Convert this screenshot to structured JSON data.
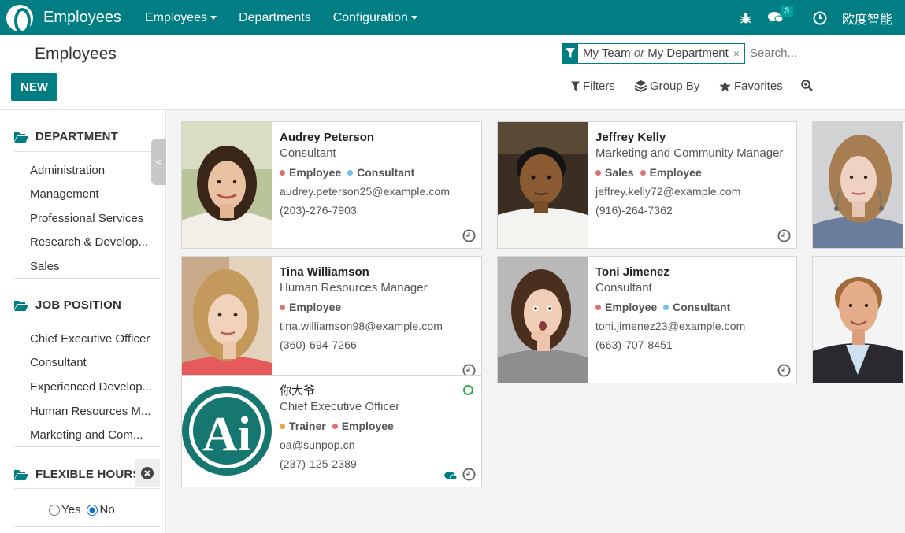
{
  "navbar": {
    "app_name": "Employees",
    "menus": [
      "Employees",
      "Departments",
      "Configuration"
    ],
    "messages_count": "3",
    "company": "欧度智能",
    "icons": [
      "bug-icon",
      "chat-icon",
      "clock-icon"
    ]
  },
  "control_panel": {
    "title": "Employees",
    "new_label": "NEW",
    "facet": {
      "part1": "My Team",
      "connector": "or",
      "part2": "My Department"
    },
    "search_placeholder": "Search...",
    "filters_label": "Filters",
    "groupby_label": "Group By",
    "favorites_label": "Favorites"
  },
  "sidebar": {
    "department": {
      "title": "DEPARTMENT",
      "items": [
        "Administration",
        "Management",
        "Professional Services",
        "Research & Develop...",
        "Sales"
      ]
    },
    "job_position": {
      "title": "JOB POSITION",
      "items": [
        "Chief Executive Officer",
        "Consultant",
        "Experienced Develop...",
        "Human Resources M...",
        "Marketing and Com..."
      ]
    },
    "flexible_hours": {
      "title": "FLEXIBLE HOURS",
      "yes": "Yes",
      "no": "No",
      "selected": "No"
    }
  },
  "colors": {
    "brand": "#017e84",
    "tag_employee": "#e07070",
    "tag_consultant": "#6cc1ed",
    "tag_sales": "#e07070",
    "tag_trainer": "#f0a050"
  },
  "cards": [
    {
      "name": "Audrey Peterson",
      "job": "Consultant",
      "tags": [
        "Employee",
        "Consultant"
      ],
      "email": "audrey.peterson25@example.com",
      "phone": "(203)-276-7903"
    },
    {
      "name": "Jeffrey Kelly",
      "job": "Marketing and Community Manager",
      "tags": [
        "Sales",
        "Employee"
      ],
      "email": "jeffrey.kelly72@example.com",
      "phone": "(916)-264-7362"
    },
    {
      "name": "Tina Williamson",
      "job": "Human Resources Manager",
      "tags": [
        "Employee"
      ],
      "email": "tina.williamson98@example.com",
      "phone": "(360)-694-7266"
    },
    {
      "name": "Toni Jimenez",
      "job": "Consultant",
      "tags": [
        "Employee",
        "Consultant"
      ],
      "email": "toni.jimenez23@example.com",
      "phone": "(663)-707-8451"
    },
    {
      "name": "你大爷",
      "job": "Chief Executive Officer",
      "tags": [
        "Trainer",
        "Employee"
      ],
      "email": "oa@sunpop.cn",
      "phone": "(237)-125-2389",
      "logo_text": "Ai"
    }
  ]
}
